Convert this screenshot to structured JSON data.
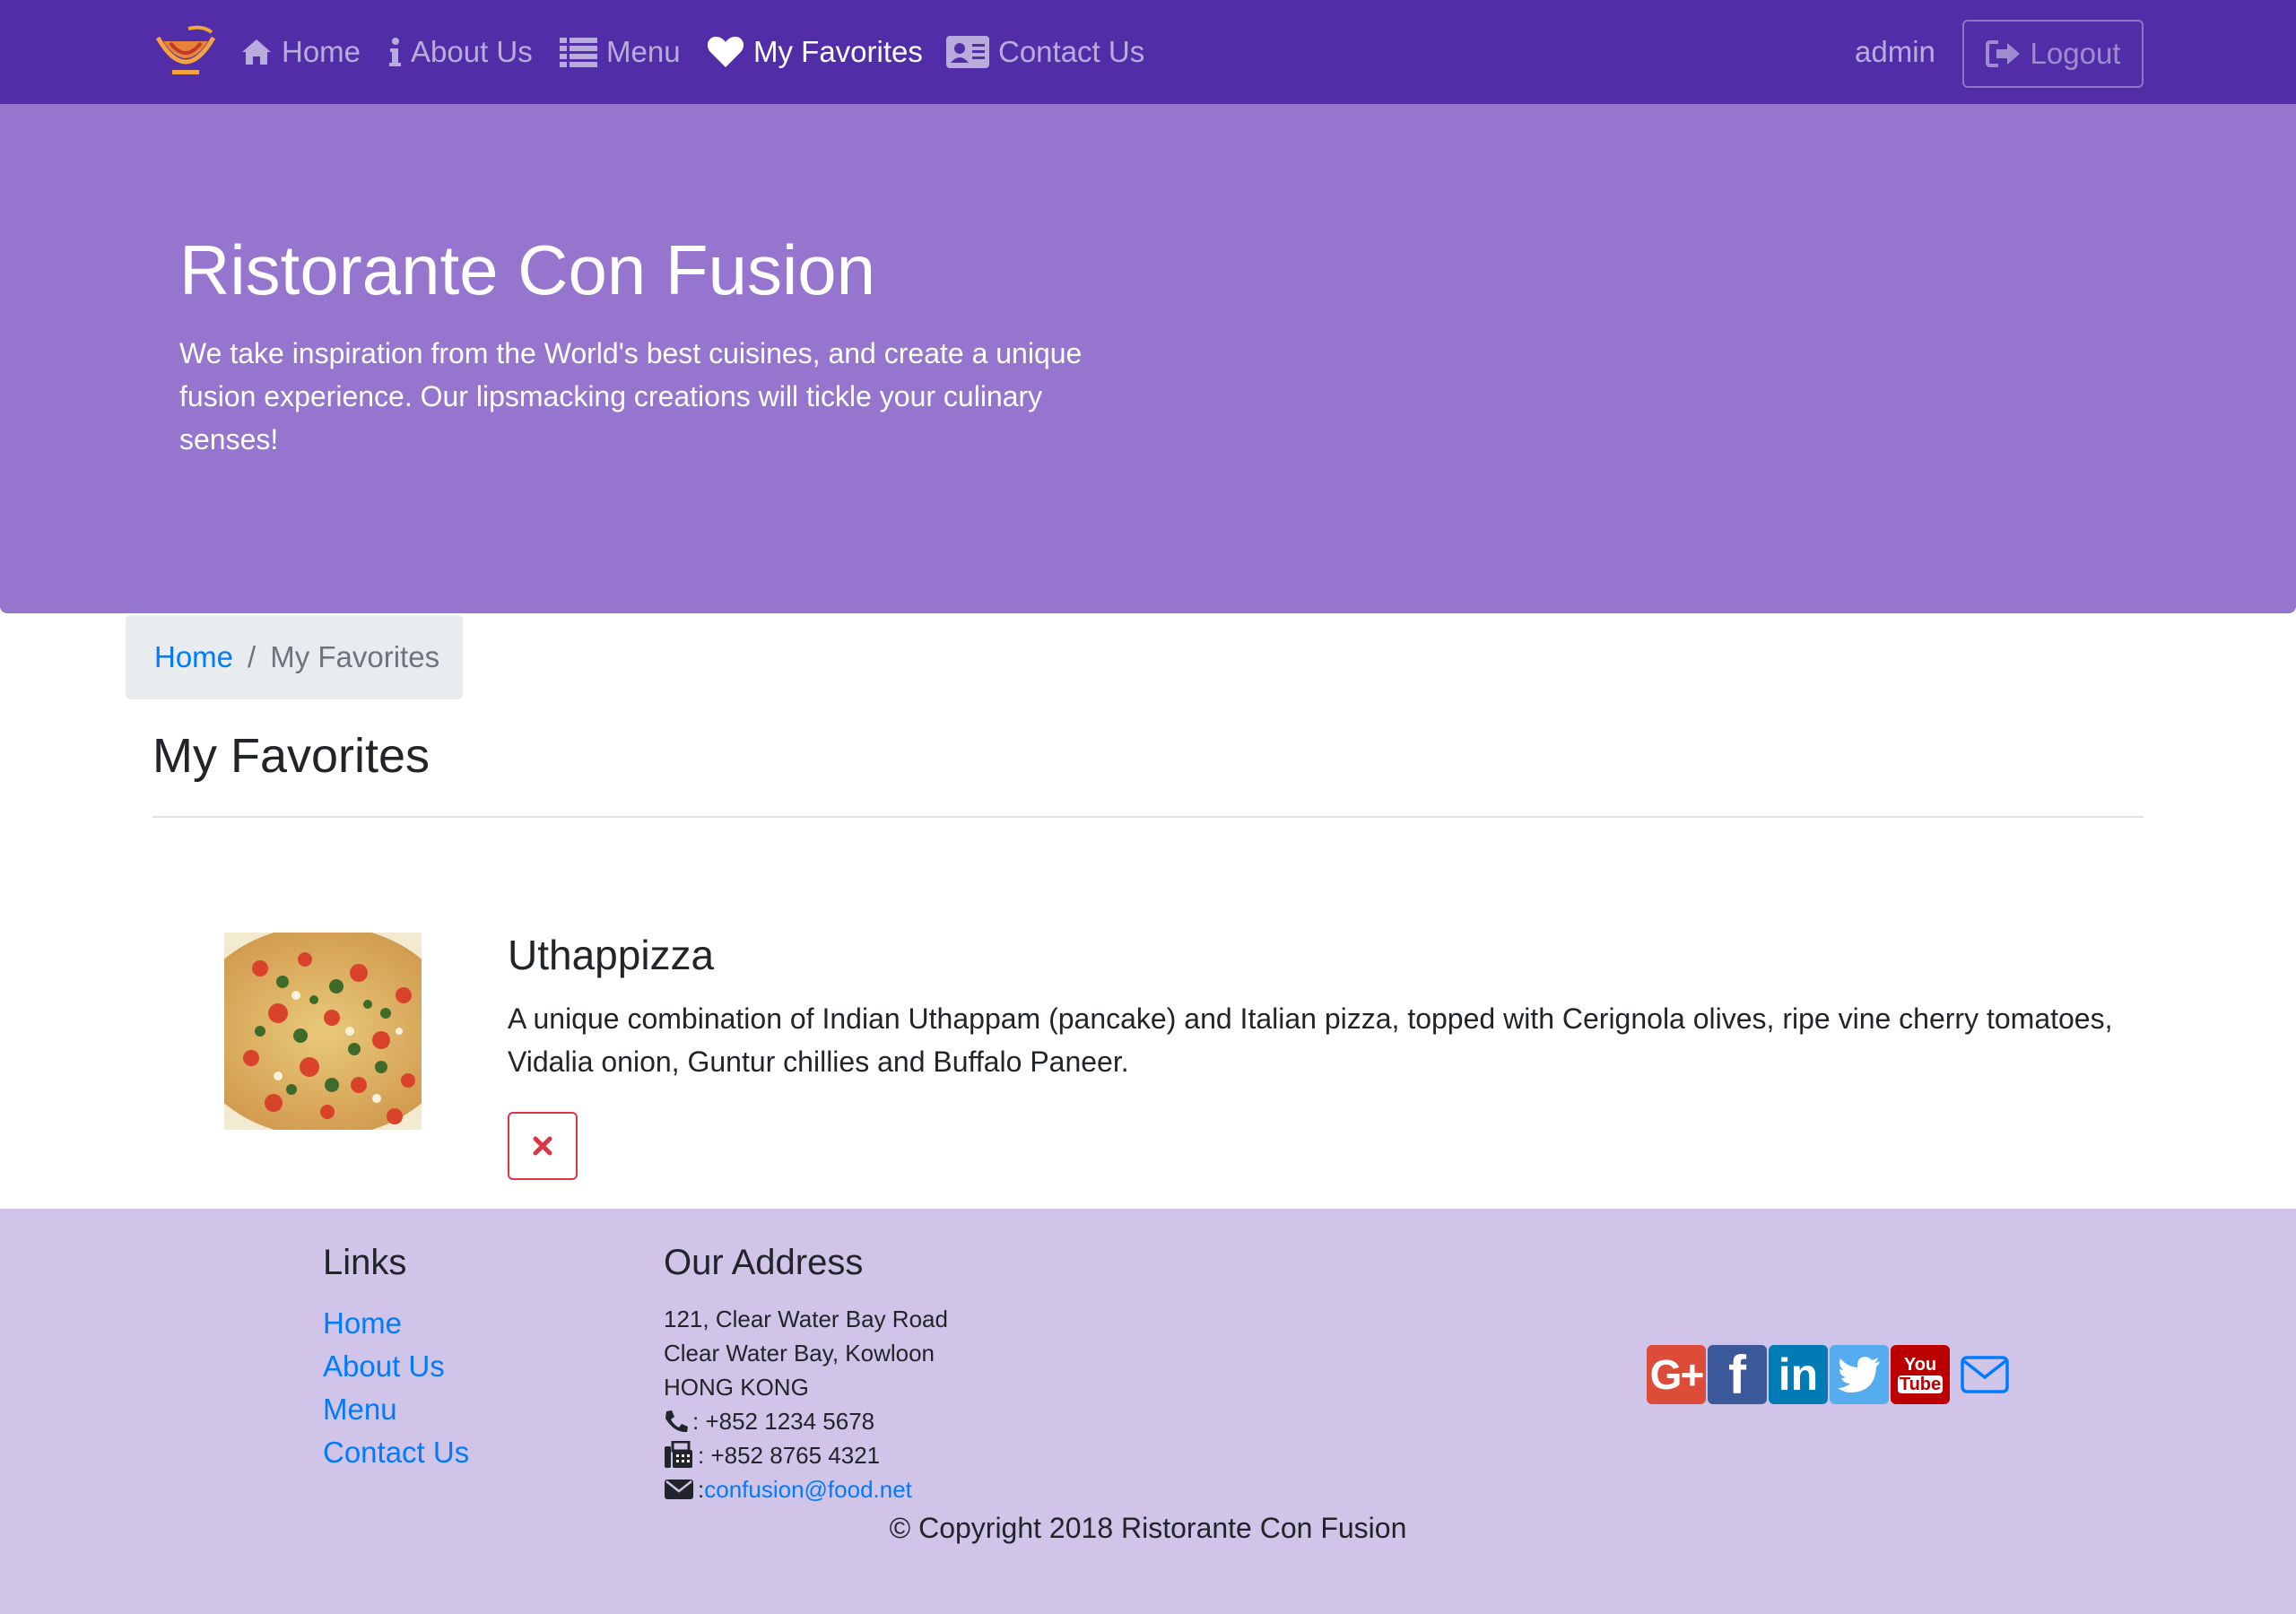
{
  "navbar": {
    "brand_alt": "Ristorante Con Fusion",
    "items": [
      {
        "label": "Home",
        "icon": "home-icon"
      },
      {
        "label": "About Us",
        "icon": "info-icon"
      },
      {
        "label": "Menu",
        "icon": "list-icon"
      },
      {
        "label": "My Favorites",
        "icon": "heart-icon",
        "active": true
      },
      {
        "label": "Contact Us",
        "icon": "address-card-icon"
      }
    ],
    "username": "admin",
    "logout_label": "Logout"
  },
  "jumbotron": {
    "title": "Ristorante Con Fusion",
    "text": "We take inspiration from the World's best cuisines, and create a unique fusion experience. Our lipsmacking creations will tickle your culinary senses!"
  },
  "breadcrumb": {
    "home": "Home",
    "separator": "/",
    "active": "My Favorites"
  },
  "page": {
    "title": "My Favorites"
  },
  "favorites": [
    {
      "name": "Uthappizza",
      "description": "A unique combination of Indian Uthappam (pancake) and Italian pizza, topped with Cerignola olives, ripe vine cherry tomatoes, Vidalia onion, Guntur chillies and Buffalo Paneer.",
      "delete_icon": "times-icon"
    }
  ],
  "footer": {
    "links_title": "Links",
    "links": [
      "Home",
      "About Us",
      "Menu",
      "Contact Us"
    ],
    "address_title": "Our Address",
    "address_lines": [
      "121, Clear Water Bay Road",
      "Clear Water Bay, Kowloon",
      "HONG KONG"
    ],
    "phone": ": +852 1234 5678",
    "fax": ": +852 8765 4321",
    "email_prefix": ": ",
    "email": "confusion@food.net",
    "social": {
      "google": "G+",
      "facebook": "f",
      "linkedin": "in",
      "youtube_top": "You",
      "youtube_bottom": "Tube"
    },
    "copyright": "© Copyright 2018 Ristorante Con Fusion"
  },
  "colors": {
    "navbar": "#512da8",
    "jumbotron": "#9575cd",
    "footer": "#d1c4e9",
    "link": "#007bff",
    "danger": "#dc3545"
  }
}
